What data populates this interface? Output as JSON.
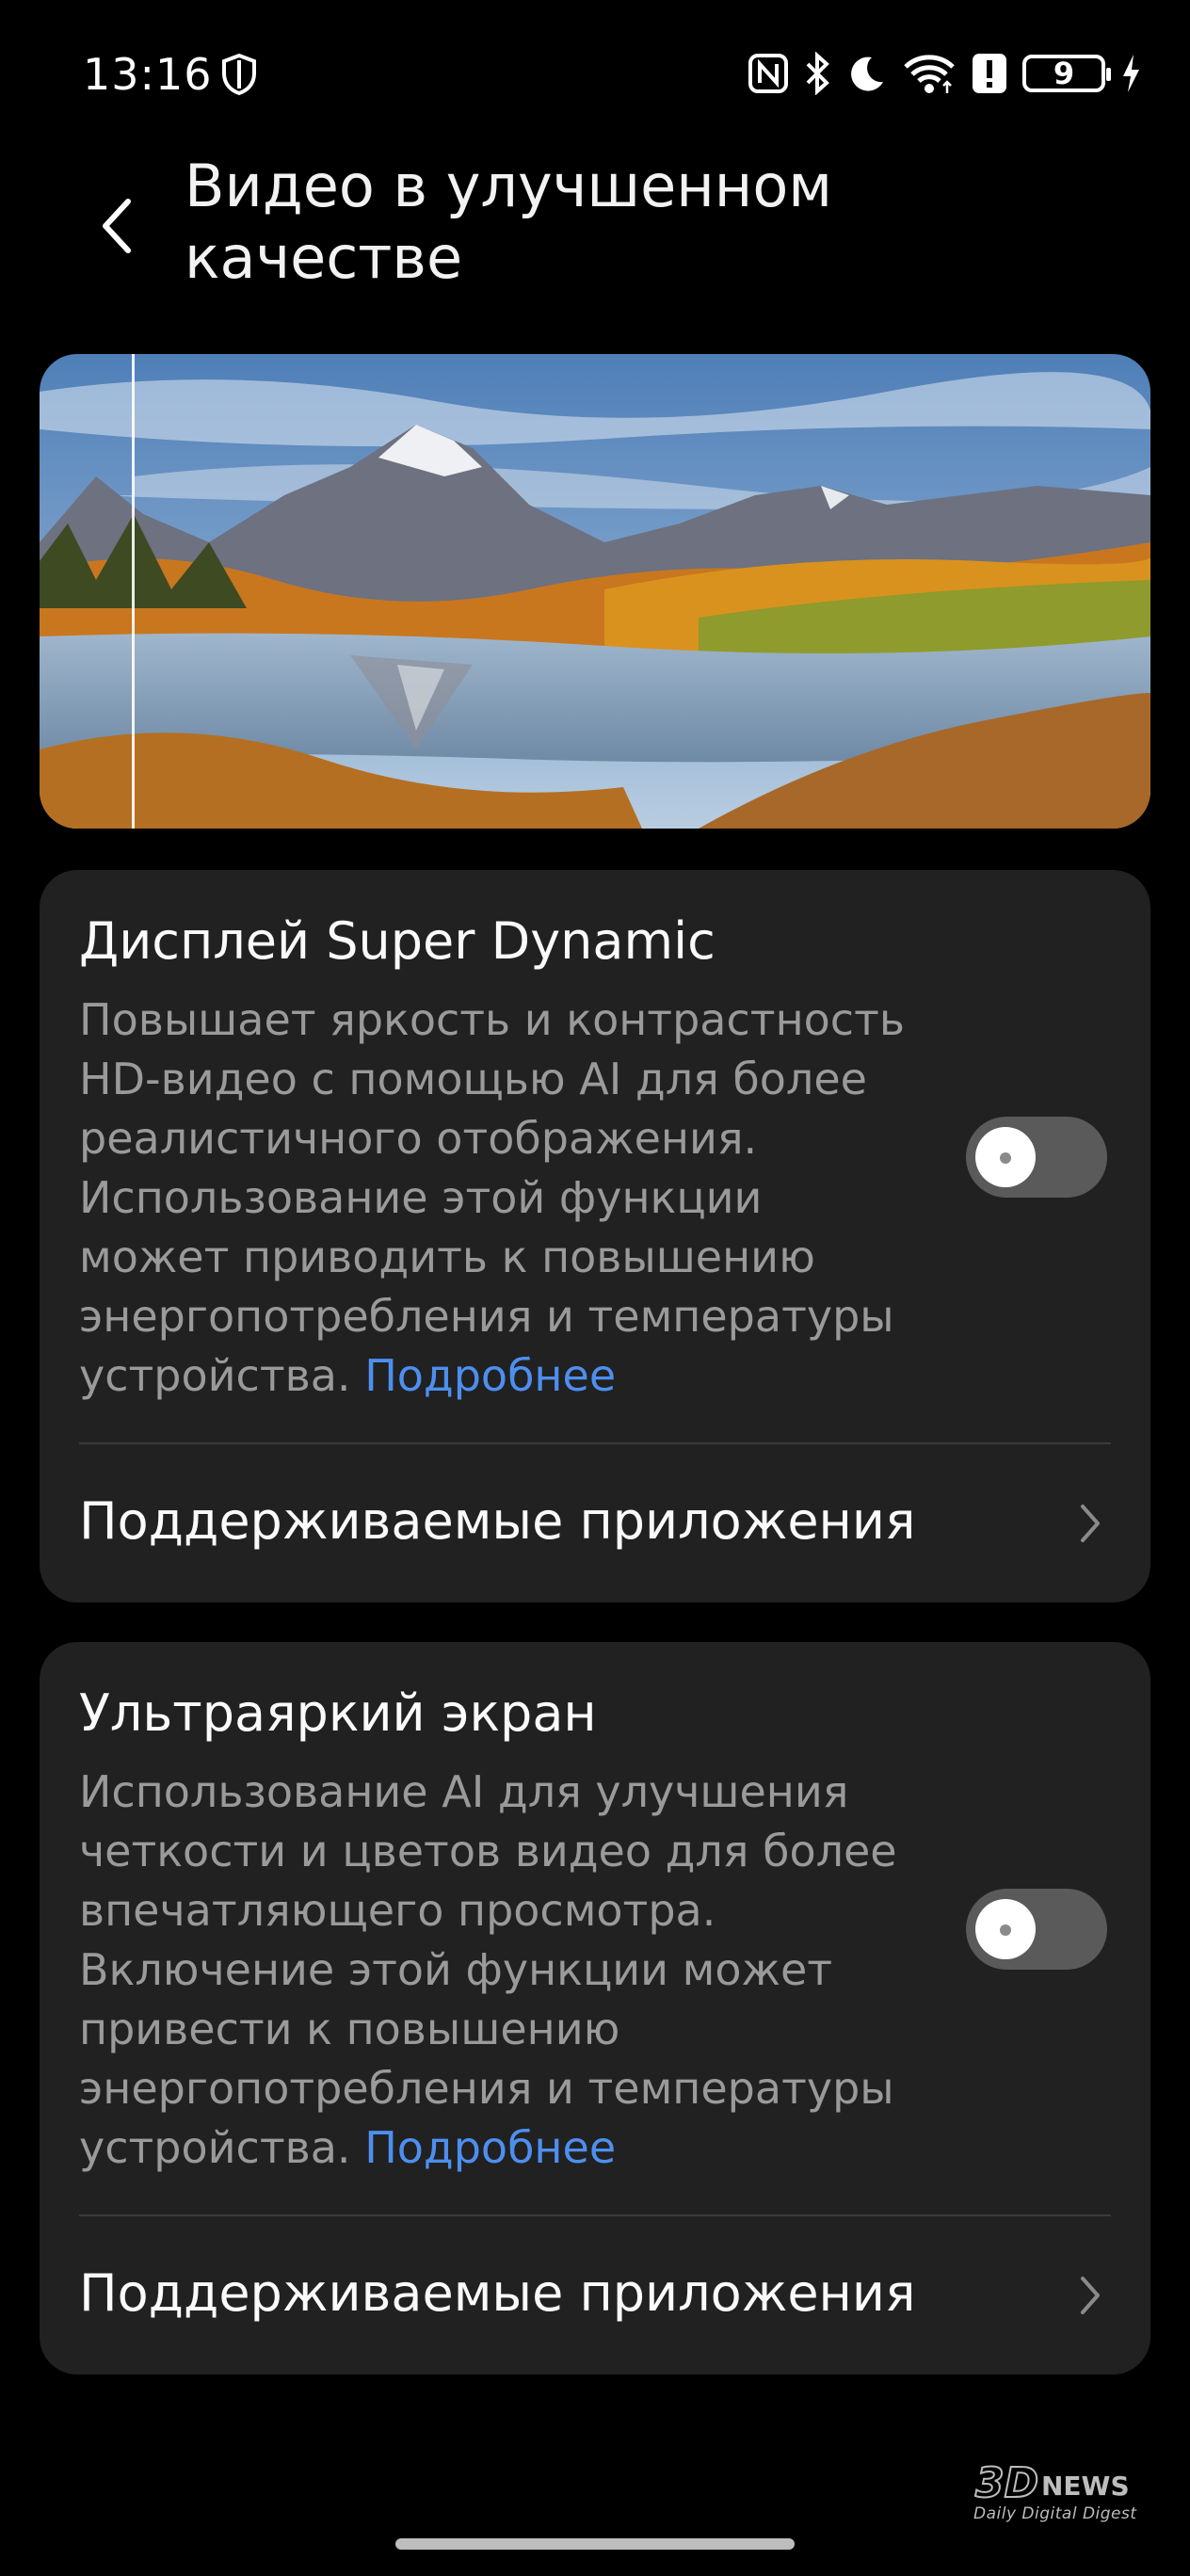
{
  "status_bar": {
    "time": "13:16",
    "battery": "9",
    "icons": [
      "shield-icon",
      "nfc-icon",
      "bluetooth-icon",
      "moon-icon",
      "wifi-icon",
      "alert-icon",
      "battery-icon",
      "charging-icon"
    ]
  },
  "header": {
    "title_line1": "Видео в улучшенном",
    "title_line2": "качестве"
  },
  "sections": [
    {
      "title": "Дисплей Super Dynamic",
      "description": "Повышает яркость и контрастность HD-видео с помощью AI для более реалистичного отображения. Использование этой функции может приводить к повышению энергопотребления и температуры устройства.",
      "more_link": "Подробнее",
      "toggle": false,
      "row_label": "Поддерживаемые приложения"
    },
    {
      "title": "Ультраяркий экран",
      "description": "Использование AI для улучшения четкости и цветов видео для более впечатляющего просмотра. Включение этой функции может привести к повышению энергопотребления и температуры устройства.",
      "more_link": "Подробнее",
      "toggle": false,
      "row_label": "Поддерживаемые приложения"
    }
  ],
  "watermark": {
    "logo": "3DNEWS",
    "subtitle": "Daily Digital Digest"
  },
  "colors": {
    "background": "#000000",
    "card": "#212121",
    "link": "#4d8ff0",
    "toggle_off": "#5a5a5a"
  }
}
